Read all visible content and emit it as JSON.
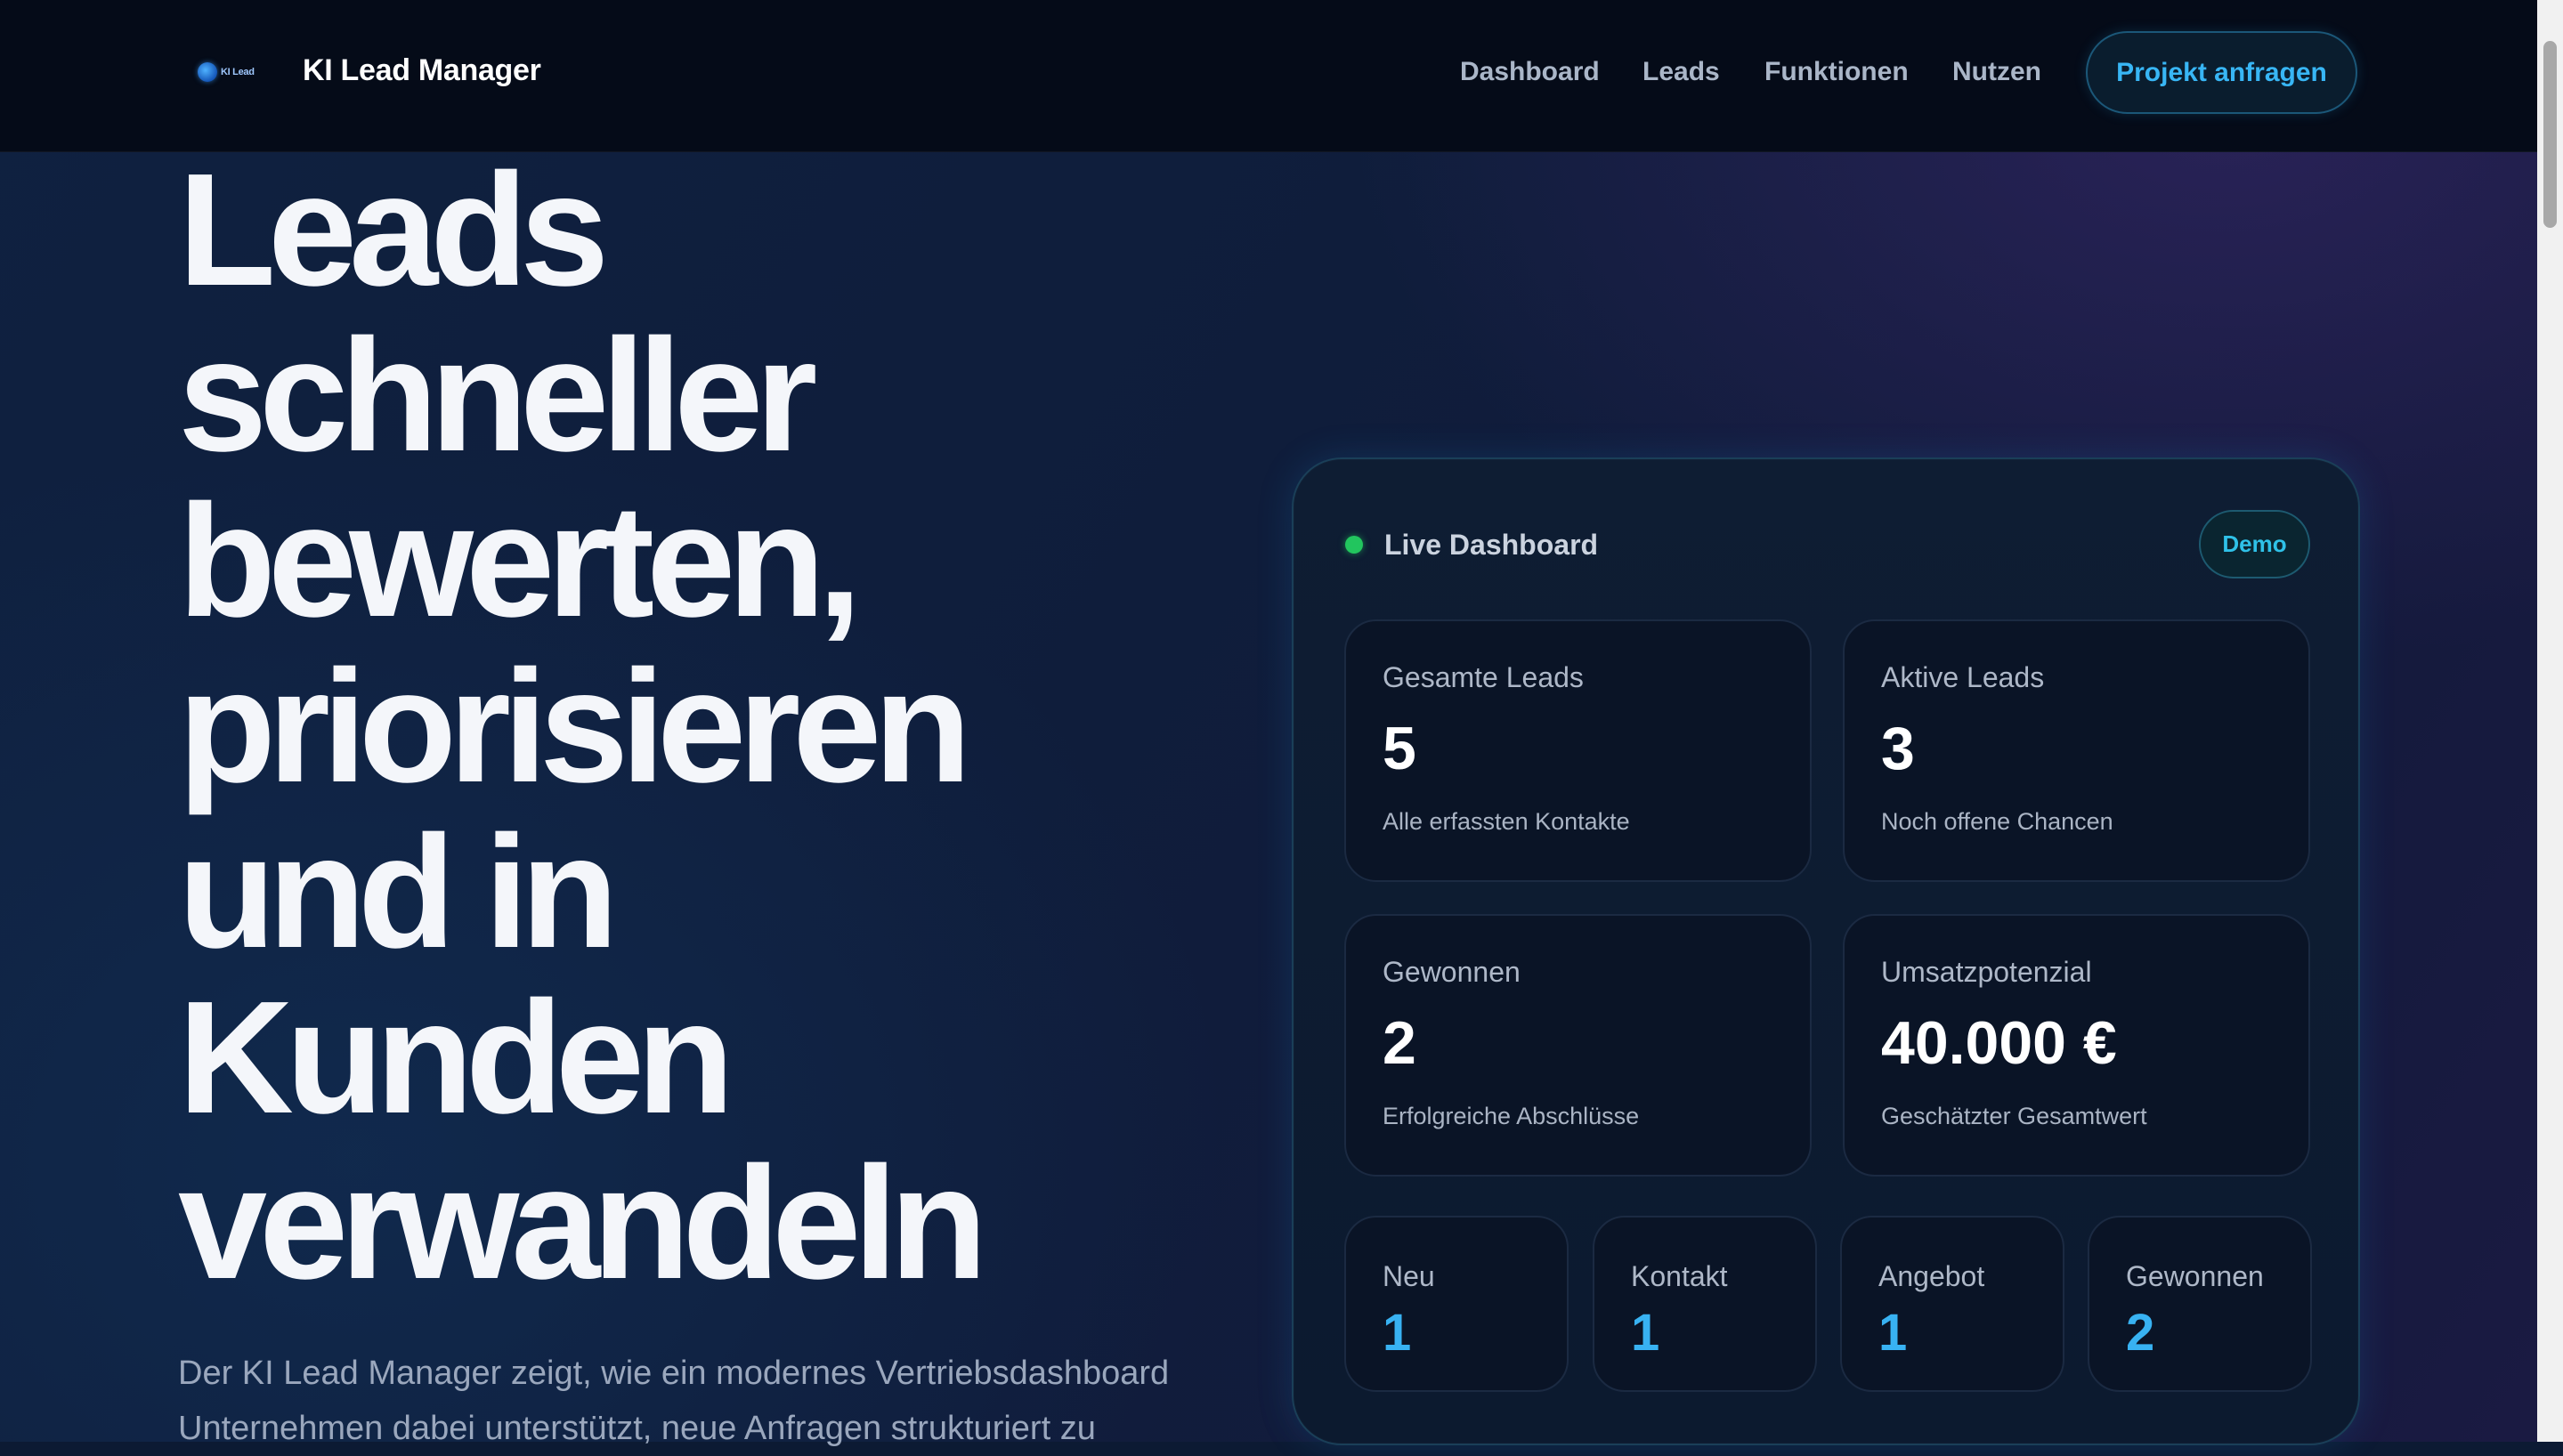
{
  "header": {
    "logo_text": "KI Lead",
    "brand": "KI Lead Manager",
    "nav": [
      {
        "label": "Dashboard"
      },
      {
        "label": "Leads"
      },
      {
        "label": "Funktionen"
      },
      {
        "label": "Nutzen"
      }
    ],
    "cta_label": "Projekt anfragen"
  },
  "hero": {
    "title": "Leads\nschneller\nbewerten,\npriorisieren\nund in\nKunden\nverwandeln",
    "subtitle": "Der KI Lead Manager zeigt, wie ein modernes Vertriebsdashboard Unternehmen dabei unterstützt, neue Anfragen strukturiert zu"
  },
  "dashboard": {
    "title": "Live Dashboard",
    "badge": "Demo",
    "stats": [
      {
        "label": "Gesamte Leads",
        "value": "5",
        "desc": "Alle erfassten Kontakte"
      },
      {
        "label": "Aktive Leads",
        "value": "3",
        "desc": "Noch offene Chancen"
      },
      {
        "label": "Gewonnen",
        "value": "2",
        "desc": "Erfolgreiche Abschlüsse"
      },
      {
        "label": "Umsatzpotenzial",
        "value": "40.000 €",
        "desc": "Geschätzter Gesamtwert"
      }
    ],
    "stages": [
      {
        "label": "Neu",
        "value": "1"
      },
      {
        "label": "Kontakt",
        "value": "1"
      },
      {
        "label": "Angebot",
        "value": "1"
      },
      {
        "label": "Gewonnen",
        "value": "2"
      }
    ]
  },
  "colors": {
    "accent": "#38b2f2",
    "live_status": "#22c55e",
    "nav_background": "#050b18",
    "page_background": "#0f2140"
  },
  "icons": {
    "logo": "ki-lead-logo-icon",
    "live": "live-status-dot-icon"
  }
}
